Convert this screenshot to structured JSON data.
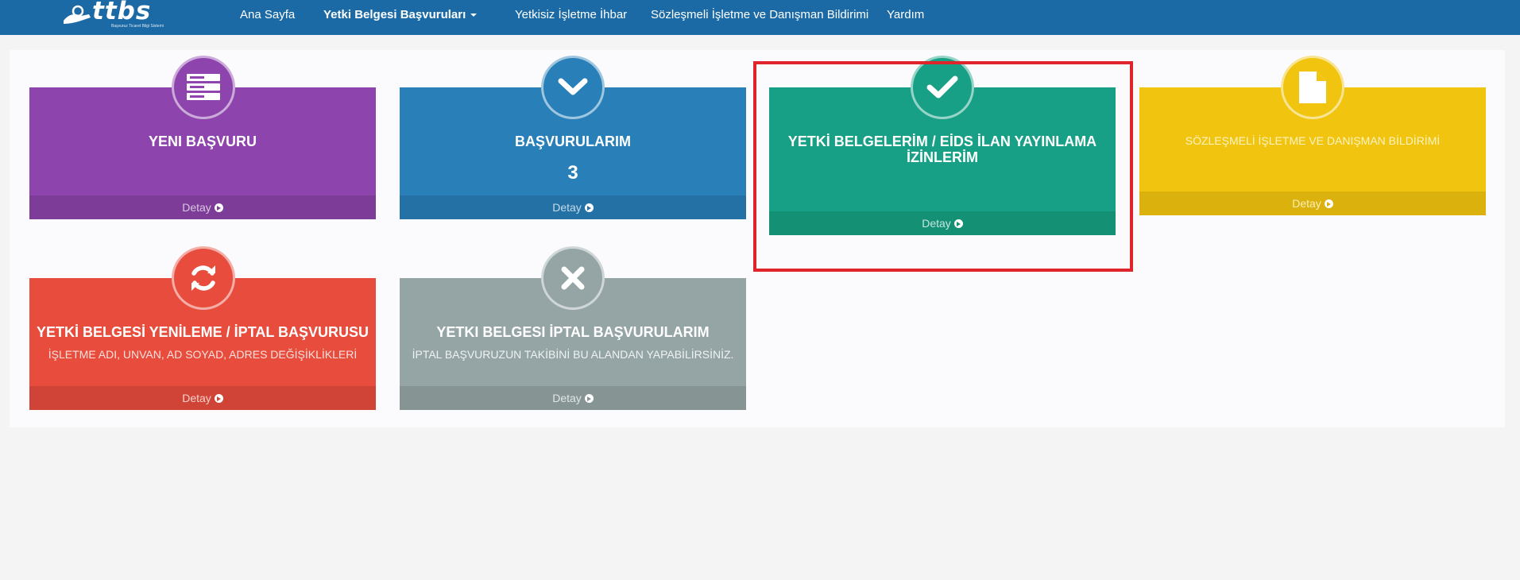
{
  "brand": {
    "logo_text": "ttbs",
    "logo_sub": "Başvuruz Ticaret Bilgi Sistemi"
  },
  "nav": {
    "home": "Ana Sayfa",
    "applications": "Yetki Belgesi Başvuruları",
    "report": "Yetkisiz İşletme İhbar",
    "contract": "Sözleşmeli İşletme ve Danışman Bildirimi",
    "help": "Yardım"
  },
  "cards": [
    {
      "title": "YENI BAŞVURU",
      "footer": "Detay",
      "icon": "server-icon",
      "color": "#8e44ad"
    },
    {
      "title": "BAŞVURULARIM",
      "count": "3",
      "footer": "Detay",
      "icon": "chevron-down-icon",
      "color": "#2980b9"
    },
    {
      "title": "YETKİ BELGELERİM / EİDS İLAN YAYINLAMA İZİNLERİM",
      "footer": "Detay",
      "icon": "check-icon",
      "color": "#17a085"
    },
    {
      "title": "SÖZLEŞMELİ İŞLETME VE DANIŞMAN BİLDİRİMİ",
      "footer": "Detay",
      "icon": "file-icon",
      "color": "#f1c40f"
    },
    {
      "title": "YETKİ BELGESİ YENİLEME / İPTAL BAŞVURUSU",
      "subtitle": "İŞLETME ADI, UNVAN, AD SOYAD, ADRES DEĞİŞİKLİKLERİ",
      "footer": "Detay",
      "icon": "refresh-icon",
      "color": "#e74c3c"
    },
    {
      "title": "YETKI BELGESI İPTAL BAŞVURULARIM",
      "subtitle": "İPTAL BAŞVURUZUN TAKİBİNİ BU ALANDAN YAPABİLİRSİNİZ.",
      "footer": "Detay",
      "icon": "close-icon",
      "color": "#95a5a6"
    }
  ]
}
